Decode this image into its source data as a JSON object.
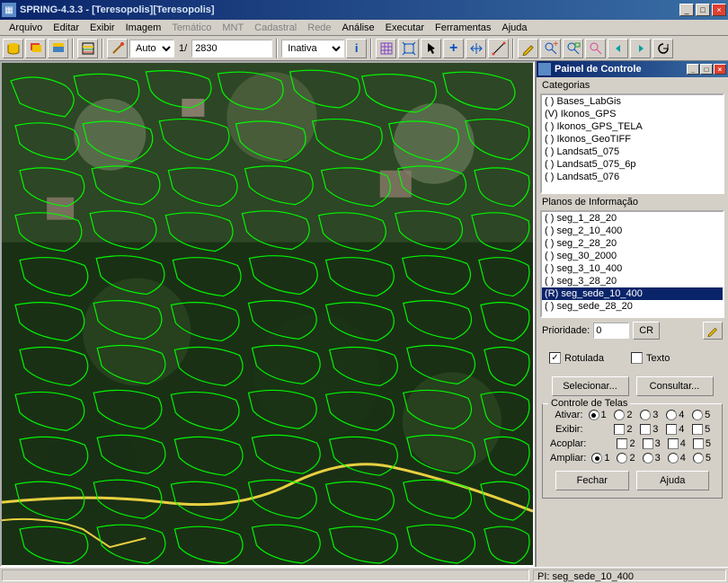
{
  "window": {
    "title": "SPRING-4.3.3 - [Teresopolis][Teresopolis]",
    "min": "_",
    "max": "□",
    "close": "×"
  },
  "menu": {
    "arquivo": "Arquivo",
    "editar": "Editar",
    "exibir": "Exibir",
    "imagem": "Imagem",
    "tematico": "Temático",
    "mnt": "MNT",
    "cadastral": "Cadastral",
    "rede": "Rede",
    "analise": "Análise",
    "executar": "Executar",
    "ferramentas": "Ferramentas",
    "ajuda": "Ajuda"
  },
  "toolbar": {
    "scale_mode": "Auto",
    "scale_num": "1/",
    "scale_val": "2830",
    "status": "Inativa"
  },
  "panel": {
    "title": "Painel de Controle",
    "categorias_label": "Categorias",
    "categorias": [
      "( ) Bases_LabGis",
      "(V) Ikonos_GPS",
      "( ) Ikonos_GPS_TELA",
      "( ) Ikonos_GeoTIFF",
      "( ) Landsat5_075",
      "( ) Landsat5_075_6p",
      "( ) Landsat5_076"
    ],
    "planos_label": "Planos de Informação",
    "planos": [
      "( ) seg_1_28_20",
      "( ) seg_2_10_400",
      "( ) seg_2_28_20",
      "( ) seg_30_2000",
      "( ) seg_3_10_400",
      "( ) seg_3_28_20",
      "(R) seg_sede_10_400",
      "( ) seg_sede_28_20"
    ],
    "planos_selected_index": 6,
    "prioridade_label": "Prioridade:",
    "prioridade_value": "0",
    "cr_label": "CR",
    "rotulada_label": "Rotulada",
    "rotulada_checked": true,
    "texto_label": "Texto",
    "texto_checked": false,
    "selecionar_label": "Selecionar...",
    "consultar_label": "Consultar...",
    "controle_telas_label": "Controle de Telas",
    "ativar_label": "Ativar:",
    "exibir_label": "Exibir:",
    "acoplar_label": "Acoplar:",
    "ampliar_label": "Ampliar:",
    "cols": [
      "1",
      "2",
      "3",
      "4",
      "5"
    ],
    "ativar_sel": 0,
    "ampliar_sel": 0,
    "fechar_label": "Fechar",
    "ajuda_label": "Ajuda"
  },
  "status": {
    "right": "PI: seg_sede_10_400"
  }
}
